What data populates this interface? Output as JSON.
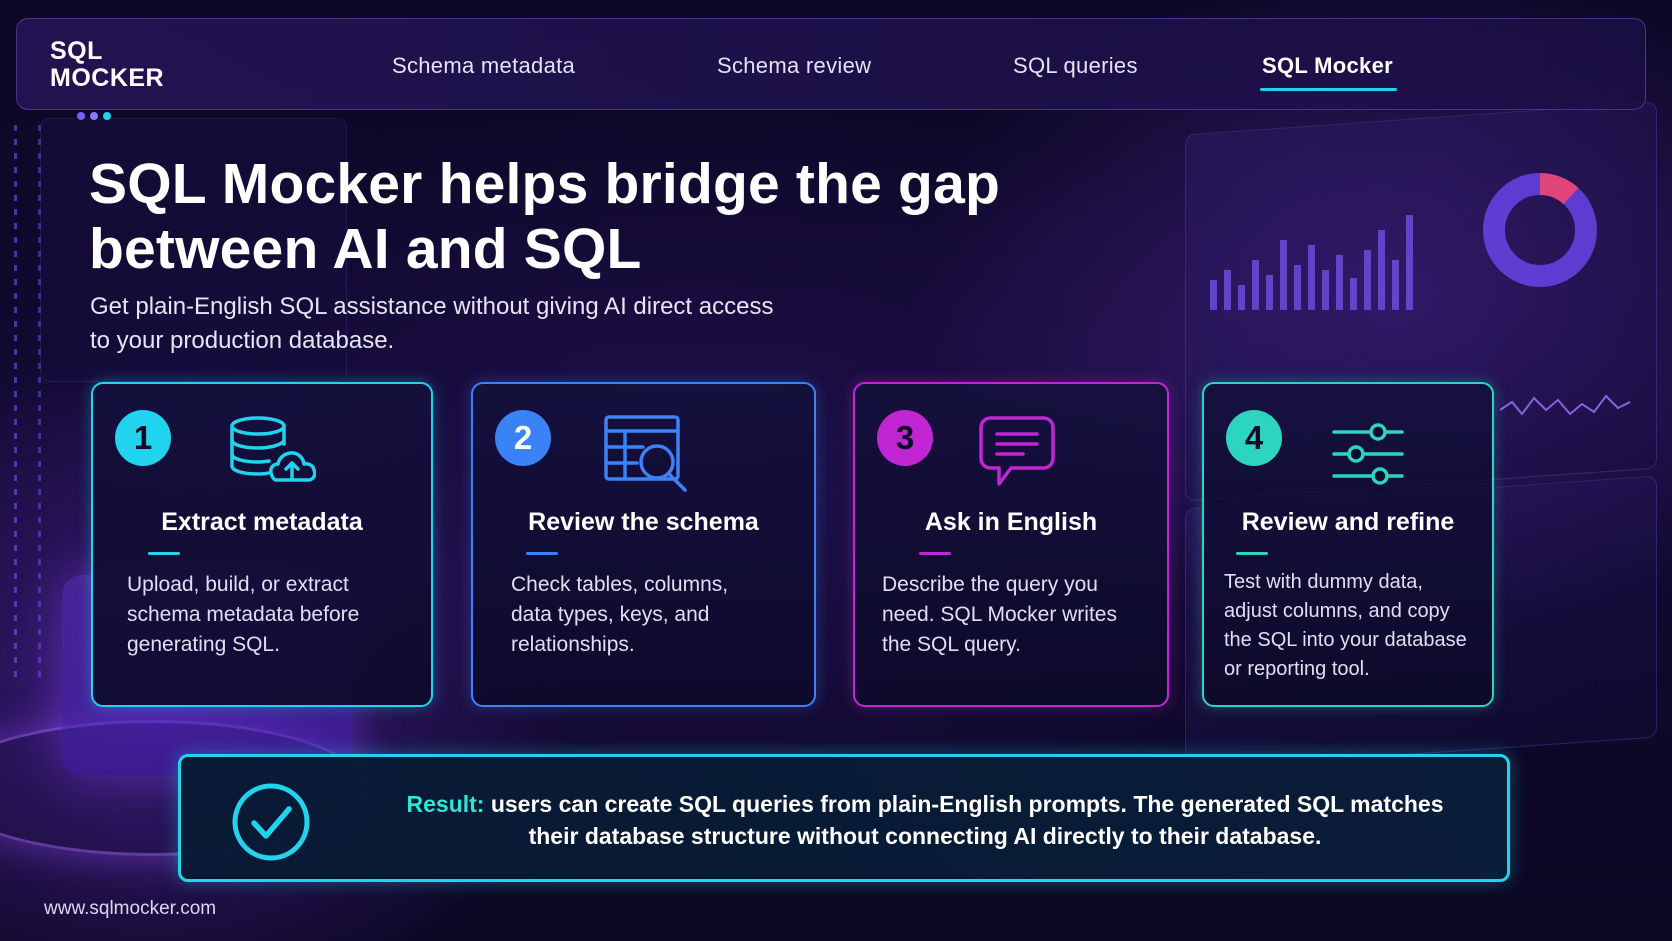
{
  "brand": {
    "logo_line1": "SQL",
    "logo_line2": "MOCKER",
    "dot_colors": [
      "#7c5cff",
      "#8b7cff",
      "#22d3ee"
    ]
  },
  "nav": {
    "items": [
      {
        "label": "Schema metadata",
        "active": false
      },
      {
        "label": "Schema review",
        "active": false
      },
      {
        "label": "SQL queries",
        "active": false
      },
      {
        "label": "SQL Mocker",
        "active": true
      }
    ],
    "active_indicator_color": "#22d3ee"
  },
  "hero": {
    "headline_line1": "SQL Mocker helps bridge the gap",
    "headline_line2": "between AI and SQL",
    "subhead_line1": "Get plain-English SQL assistance without giving AI direct access",
    "subhead_line2": "to your production database."
  },
  "steps": [
    {
      "number": "1",
      "icon": "database-upload-icon",
      "title": "Extract metadata",
      "description": [
        "Upload, build, or extract",
        "schema metadata before",
        "generating SQL."
      ],
      "accent": "#22d3ee"
    },
    {
      "number": "2",
      "icon": "table-search-icon",
      "title": "Review the schema",
      "description": [
        "Check tables, columns,",
        "data types, keys, and",
        "relationships."
      ],
      "accent": "#3b82f6"
    },
    {
      "number": "3",
      "icon": "chat-bubble-icon",
      "title": "Ask in English",
      "description": [
        "Describe the query you",
        "need. SQL Mocker writes",
        "the SQL query."
      ],
      "accent": "#c026d3"
    },
    {
      "number": "4",
      "icon": "sliders-icon",
      "title": "Review and refine",
      "description": [
        "Test with dummy data,",
        "adjust columns, and copy",
        "the SQL into your database",
        "or reporting tool."
      ],
      "accent": "#2dd4bf"
    }
  ],
  "result": {
    "label": "Result:",
    "text_line1": "users can create SQL queries from plain-English prompts. The generated SQL matches",
    "text_line2": "their database structure without connecting AI directly to their database.",
    "icon": "check-circle-icon",
    "accent": "#22d3ee"
  },
  "footer": {
    "url": "www.sqlmocker.com"
  }
}
